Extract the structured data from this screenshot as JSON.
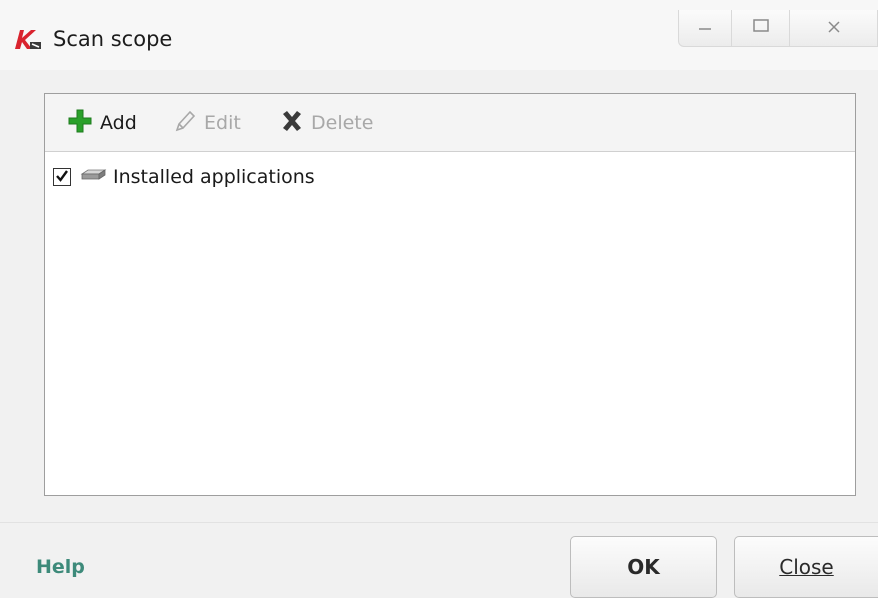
{
  "window": {
    "title": "Scan scope",
    "logo_icon": "kaspersky-k-icon",
    "caption": {
      "minimize_icon": "minimize-icon",
      "maximize_icon": "maximize-icon",
      "close_icon": "close-icon"
    }
  },
  "toolbar": {
    "add_label": "Add",
    "add_icon": "plus-icon",
    "edit_label": "Edit",
    "edit_icon": "pencil-icon",
    "delete_label": "Delete",
    "delete_icon": "x-icon"
  },
  "scope_list": {
    "items": [
      {
        "label": "Installed applications",
        "checked": true,
        "icon": "drive-icon"
      }
    ]
  },
  "footer": {
    "help_label": "Help",
    "ok_label": "OK",
    "close_label": "Close"
  },
  "colors": {
    "add_icon": "#2aa02a",
    "help_link": "#3d8a7a",
    "disabled_text": "#a8a8a8",
    "logo_red": "#d9232e"
  }
}
